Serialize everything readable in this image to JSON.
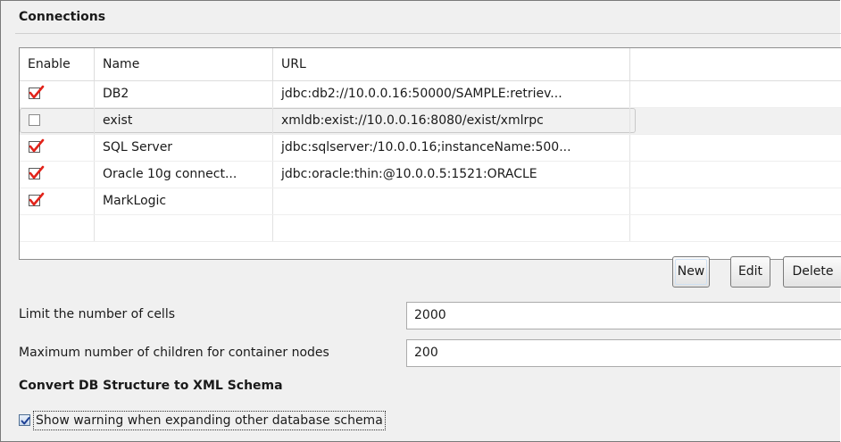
{
  "section": {
    "title": "Connections"
  },
  "table": {
    "headers": {
      "enable": "Enable",
      "name": "Name",
      "url": "URL"
    },
    "rows": [
      {
        "enabled": true,
        "name": "DB2",
        "url": "jdbc:db2://10.0.0.16:50000/SAMPLE:retriev...",
        "selected": false
      },
      {
        "enabled": false,
        "name": "exist",
        "url": "xmldb:exist://10.0.0.16:8080/exist/xmlrpc",
        "selected": true
      },
      {
        "enabled": true,
        "name": "SQL Server",
        "url": "jdbc:sqlserver:/10.0.0.16;instanceName:500...",
        "selected": false
      },
      {
        "enabled": true,
        "name": "Oracle 10g connect...",
        "url": "jdbc:oracle:thin:@10.0.0.5:1521:ORACLE",
        "selected": false
      },
      {
        "enabled": true,
        "name": "MarkLogic",
        "url": "",
        "selected": false
      },
      {
        "enabled": null,
        "name": "",
        "url": "",
        "selected": false
      }
    ]
  },
  "buttons": {
    "new": "New",
    "edit": "Edit",
    "delete": "Delete"
  },
  "limits": {
    "cells_label": "Limit the number of cells",
    "cells_value": "2000",
    "children_label": "Maximum number of children for container nodes",
    "children_value": "200"
  },
  "schema": {
    "title": "Convert DB Structure to XML Schema",
    "warning_label": "Show warning when expanding other database schema",
    "warning_checked": true
  },
  "colors": {
    "check_red": "#e2231a",
    "check_blue": "#1c3f94"
  }
}
